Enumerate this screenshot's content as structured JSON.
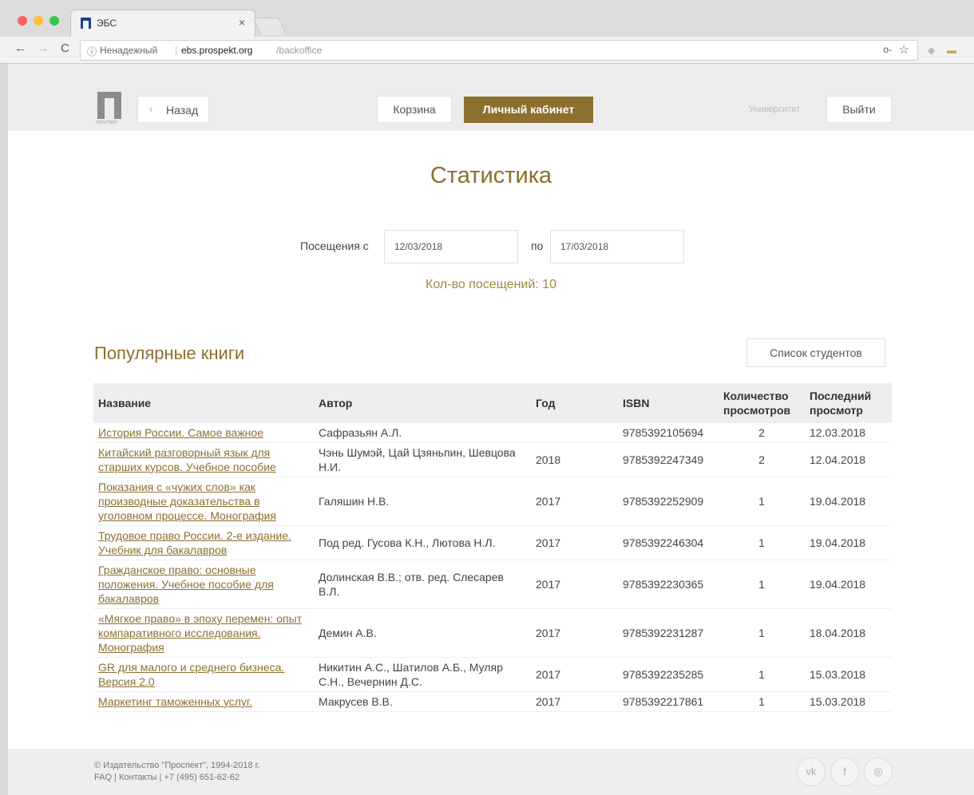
{
  "browser": {
    "tab_title": "ЭБС",
    "tab_close": "×",
    "nav": {
      "back": "←",
      "forward": "→",
      "reload": "C"
    },
    "address": {
      "info_icon": "ⓘ",
      "insecure": "Ненадежный",
      "separator": "|",
      "host": "ebs.prospekt.org",
      "path": "/backoffice"
    },
    "icons": {
      "key": "o-",
      "star": "☆"
    },
    "colors": {
      "close": "#fc605c",
      "minimize": "#fdbc40",
      "maximize": "#34c84a"
    }
  },
  "header": {
    "logo_caption": "ПРОСПЕКТ",
    "back_chevron": "‹",
    "back_label": "Назад",
    "cart_label": "Корзина",
    "cabinet_label": "Личный кабинет",
    "university": "Университет",
    "exit_label": "Выйти"
  },
  "stats": {
    "title": "Статистика",
    "visits_from_label": "Посещения с",
    "date_from": "12/03/2018",
    "to_label": "по",
    "date_to": "17/03/2018",
    "count_text": "Кол-во посещений: 10"
  },
  "popular": {
    "title": "Популярные книги",
    "students_button": "Список студентов",
    "columns": [
      "Название",
      "Автор",
      "Год",
      "ISBN",
      "Количество просмотров",
      "Последний просмотр"
    ],
    "rows": [
      {
        "title": "История России. Самое важное",
        "author": "Сафразьян А.Л.",
        "year": "",
        "isbn": "9785392105694",
        "views": "2",
        "last": "12.03.2018"
      },
      {
        "title": "Китайский разговорный язык для старших курсов. Учебное пособие",
        "author": "Чэнь Шумэй, Цай Цзяньпин, Шевцова Н.И.",
        "year": "2018",
        "isbn": "9785392247349",
        "views": "2",
        "last": "12.04.2018"
      },
      {
        "title": "Показания с «чужих слов» как производные доказательства в уголовном процессе. Монография",
        "author": "Галяшин Н.В.",
        "year": "2017",
        "isbn": "9785392252909",
        "views": "1",
        "last": "19.04.2018"
      },
      {
        "title": "Трудовое право России. 2-е издание. Учебник для бакалавров",
        "author": "Под ред. Гусова К.Н., Лютова Н.Л.",
        "year": "2017",
        "isbn": "9785392246304",
        "views": "1",
        "last": "19.04.2018"
      },
      {
        "title": "Гражданское право: основные положения. Учебное пособие для бакалавров",
        "author": "Долинская В.В.; отв. ред. Слесарев В.Л.",
        "year": "2017",
        "isbn": "9785392230365",
        "views": "1",
        "last": "19.04.2018"
      },
      {
        "title": "«Мягкое право» в эпоху перемен: опыт компаративного исследования. Монография",
        "author": "Демин А.В.",
        "year": "2017",
        "isbn": "9785392231287",
        "views": "1",
        "last": "18.04.2018"
      },
      {
        "title": "GR для малого и среднего бизнеса. Версия 2.0",
        "author": "Никитин А.С., Шатилов А.Б., Муляр С.Н., Вечернин Д.С.",
        "year": "2017",
        "isbn": "9785392235285",
        "views": "1",
        "last": "15.03.2018"
      },
      {
        "title": "Маркетинг таможенных услуг.",
        "author": "Макрусев В.В.",
        "year": "2017",
        "isbn": "9785392217861",
        "views": "1",
        "last": "15.03.2018"
      }
    ]
  },
  "footer": {
    "copyright": "© Издательство \"Проспект\", 1994-2018 г.",
    "links": "FAQ | Контакты | +7 (495) 651-62-62",
    "social": [
      "vk",
      "f",
      "◎"
    ]
  },
  "accent_color": "#8d6f2e"
}
